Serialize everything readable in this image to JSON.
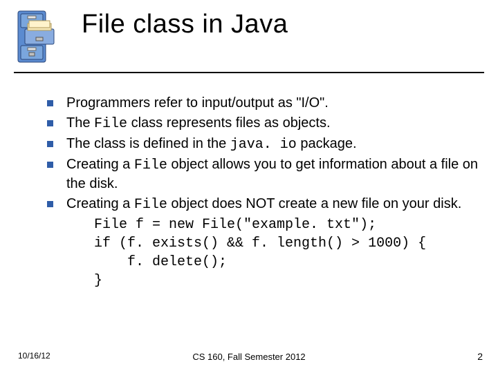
{
  "title": "File class in Java",
  "bullets": {
    "b0": "Programmers refer to input/output as \"I/O\".",
    "b1_a": "The ",
    "b1_code": "File",
    "b1_b": " class represents files as objects.",
    "b2_a": "The class is defined in the ",
    "b2_code": "java. io",
    "b2_b": " package.",
    "b3_a": "Creating a ",
    "b3_code": "File",
    "b3_b": " object allows you to get information about a file on the disk.",
    "b4_a": "Creating a ",
    "b4_code": "File",
    "b4_b": " object does NOT create a new file on your disk."
  },
  "code": {
    "l1": "File f = new File(\"example. txt\");",
    "l2": "if (f. exists() && f. length() > 1000) {",
    "l3": "    f. delete();",
    "l4": "}"
  },
  "footer": {
    "date": "10/16/12",
    "center": "CS 160, Fall Semester 2012",
    "page": "2"
  }
}
